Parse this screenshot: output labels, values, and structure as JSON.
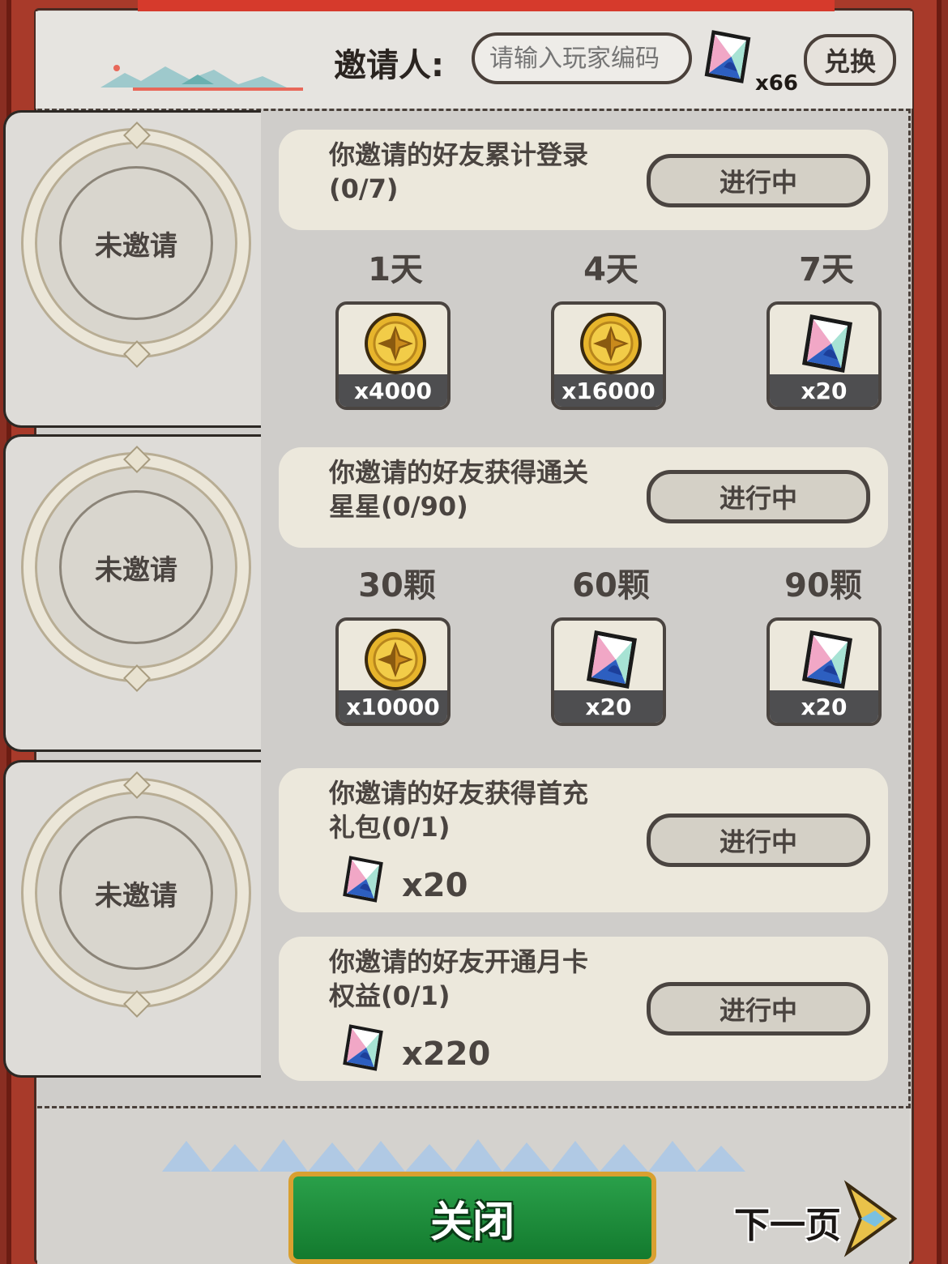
{
  "header": {
    "inviter_label": "邀请人:",
    "input_placeholder": "请输入玩家编码",
    "gem_count": "x66",
    "redeem_label": "兑换"
  },
  "invite_slots": [
    {
      "label": "未邀请"
    },
    {
      "label": "未邀请"
    },
    {
      "label": "未邀请"
    }
  ],
  "tasks": [
    {
      "title": "你邀请的好友累计登录\n(0/7)",
      "status": "进行中",
      "milestones": [
        {
          "label": "1天",
          "reward": "coin-icon",
          "qty": "x4000"
        },
        {
          "label": "4天",
          "reward": "coin-icon",
          "qty": "x16000"
        },
        {
          "label": "7天",
          "reward": "gem-icon",
          "qty": "x20"
        }
      ]
    },
    {
      "title": "你邀请的好友获得通关\n星星(0/90)",
      "status": "进行中",
      "milestones": [
        {
          "label": "30颗",
          "reward": "coin-icon",
          "qty": "x10000"
        },
        {
          "label": "60颗",
          "reward": "gem-icon",
          "qty": "x20"
        },
        {
          "label": "90颗",
          "reward": "gem-icon",
          "qty": "x20"
        }
      ]
    },
    {
      "title": "你邀请的好友获得首充\n礼包(0/1)",
      "status": "进行中",
      "reward": {
        "icon": "gem-icon",
        "qty": "x20"
      }
    },
    {
      "title": "你邀请的好友开通月卡\n权益(0/1)",
      "status": "进行中",
      "reward": {
        "icon": "gem-icon",
        "qty": "x220"
      }
    }
  ],
  "footer": {
    "close_label": "关闭",
    "next_label": "下一页"
  },
  "colors": {
    "frame": "#a83a2a",
    "paper": "#d8d6d2",
    "card": "#ece8dc",
    "close_button": "#1f8c3c",
    "text": "#4a4440"
  }
}
